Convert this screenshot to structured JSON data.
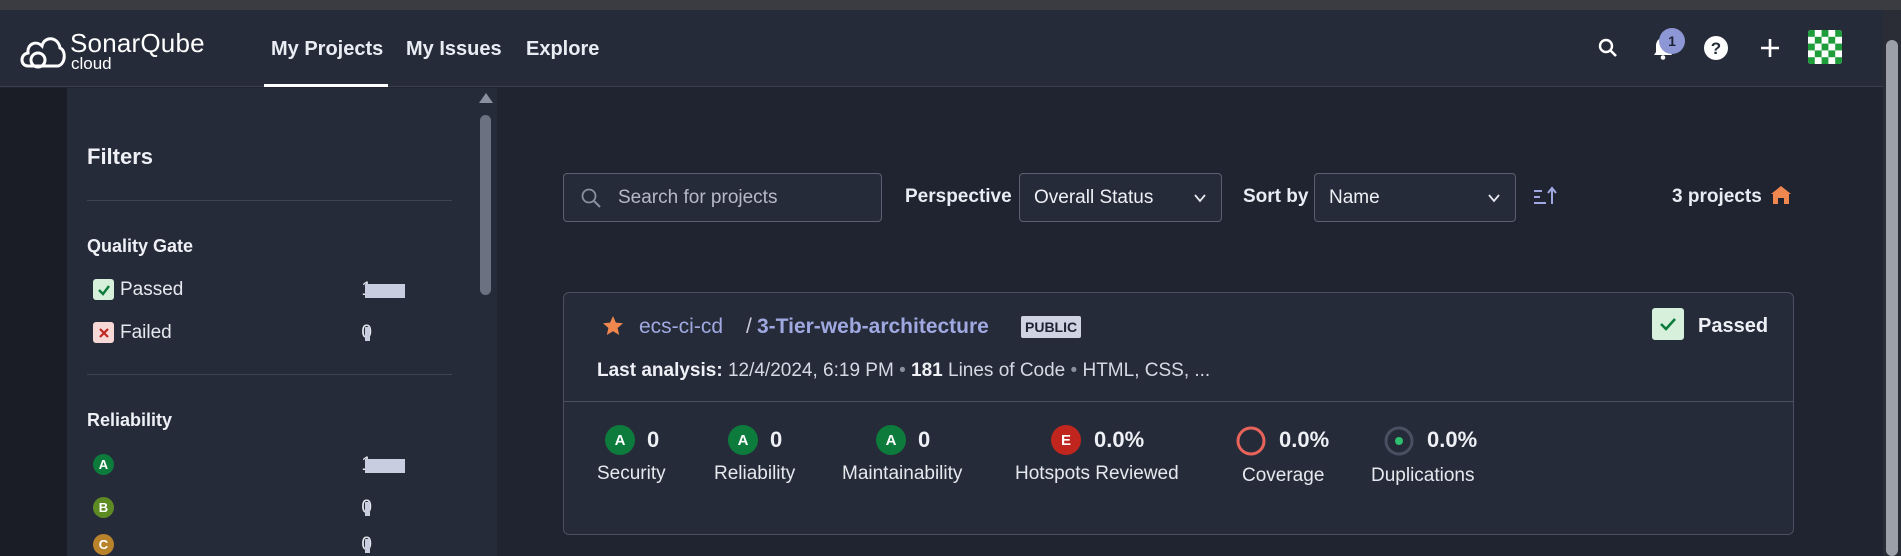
{
  "header": {
    "logo_title": "SonarQube",
    "logo_sub": "cloud",
    "nav": [
      "My Projects",
      "My Issues",
      "Explore"
    ],
    "notification_count": "1"
  },
  "sidebar": {
    "title": "Filters",
    "quality_gate": {
      "title": "Quality Gate",
      "items": [
        {
          "label": "Passed",
          "count": "1",
          "fraction": 1.0
        },
        {
          "label": "Failed",
          "count": "0",
          "fraction": 0.0
        }
      ]
    },
    "reliability": {
      "title": "Reliability",
      "items": [
        {
          "grade": "A",
          "count": "1",
          "fraction": 1.0,
          "color": "#0c7b3c"
        },
        {
          "grade": "B",
          "count": "0",
          "fraction": 0.0,
          "color": "#5e8a24"
        },
        {
          "grade": "C",
          "count": "0",
          "fraction": 0.0,
          "color": "#b9832c"
        }
      ]
    }
  },
  "toolbar": {
    "search_placeholder": "Search for projects",
    "perspective_label": "Perspective",
    "perspective_value": "Overall Status",
    "sort_label": "Sort by",
    "sort_value": "Name",
    "project_count": "3 projects"
  },
  "project": {
    "org": "ecs-ci-cd",
    "separator": "/",
    "name": "3-Tier-web-architecture",
    "visibility": "PUBLIC",
    "quality_gate": "Passed",
    "last_analysis_label": "Last analysis:",
    "last_analysis_value": "12/4/2024, 6:19 PM",
    "loc_value": "181",
    "loc_label": "Lines of Code",
    "languages": "HTML, CSS, ...",
    "metrics": [
      {
        "label": "Security",
        "grade": "A",
        "value": "0",
        "color": "#0c7b3c"
      },
      {
        "label": "Reliability",
        "grade": "A",
        "value": "0",
        "color": "#0c7b3c"
      },
      {
        "label": "Maintainability",
        "grade": "A",
        "value": "0",
        "color": "#0c7b3c"
      },
      {
        "label": "Hotspots Reviewed",
        "grade": "E",
        "value": "0.0%",
        "color": "#c0261e"
      },
      {
        "label": "Coverage",
        "value": "0.0%"
      },
      {
        "label": "Duplications",
        "value": "0.0%"
      }
    ]
  },
  "colors": {
    "accent": "#9fa8e0",
    "passed_bg": "#d6f0dc",
    "passed_check": "#0c7b3c",
    "star": "#f0874f"
  }
}
